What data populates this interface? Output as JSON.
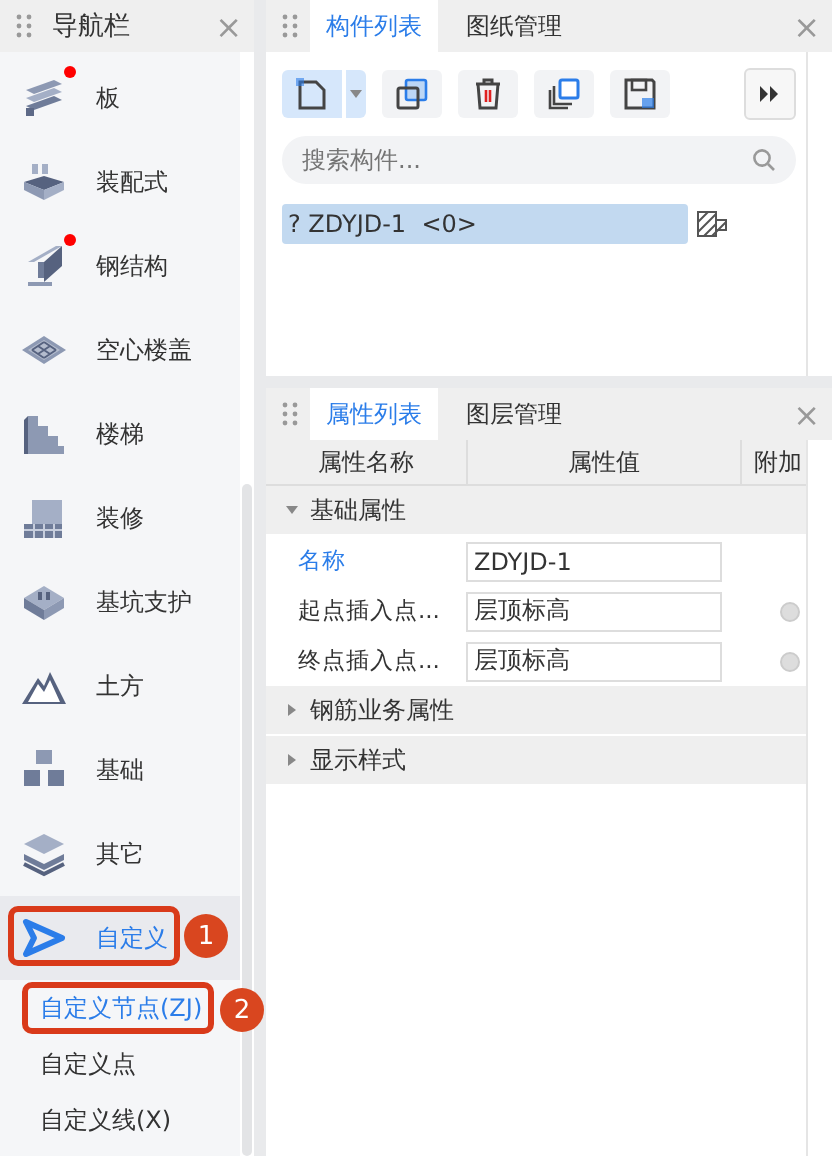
{
  "nav": {
    "title": "导航栏",
    "close": "×",
    "items": [
      {
        "label": "板",
        "badge": true,
        "selected": false
      },
      {
        "label": "装配式",
        "badge": false,
        "selected": false
      },
      {
        "label": "钢结构",
        "badge": true,
        "selected": false
      },
      {
        "label": "空心楼盖",
        "badge": false,
        "selected": false
      },
      {
        "label": "楼梯",
        "badge": false,
        "selected": false
      },
      {
        "label": "装修",
        "badge": false,
        "selected": false
      },
      {
        "label": "基坑支护",
        "badge": false,
        "selected": false
      },
      {
        "label": "土方",
        "badge": false,
        "selected": false
      },
      {
        "label": "基础",
        "badge": false,
        "selected": false
      },
      {
        "label": "其它",
        "badge": false,
        "selected": false
      },
      {
        "label": "自定义",
        "badge": false,
        "selected": true,
        "callout": "1"
      }
    ],
    "sub_items": [
      {
        "label": "自定义节点(ZJ)",
        "selected": true,
        "callout": "2"
      },
      {
        "label": "自定义点",
        "selected": false
      },
      {
        "label": "自定义线(X)",
        "selected": false
      }
    ]
  },
  "component_panel": {
    "tabs": [
      {
        "label": "构件列表",
        "selected": true
      },
      {
        "label": "图纸管理",
        "selected": false
      }
    ],
    "close": "×",
    "search": {
      "placeholder": "搜索构件..."
    },
    "items": [
      {
        "label": "? ZDYJD-1  <0>",
        "selected": true
      }
    ]
  },
  "property_panel": {
    "tabs": [
      {
        "label": "属性列表",
        "selected": true
      },
      {
        "label": "图层管理",
        "selected": false
      }
    ],
    "close": "×",
    "columns": [
      "属性名称",
      "属性值",
      "附加"
    ],
    "rows": [
      {
        "kind": "group",
        "label": "基础属性",
        "expanded": true
      },
      {
        "kind": "property",
        "name": "名称",
        "value": "ZDYJD-1",
        "highlighted": true,
        "extra": false
      },
      {
        "kind": "property",
        "name": "起点插入点...",
        "value": "层顶标高",
        "highlighted": false,
        "extra": true
      },
      {
        "kind": "property",
        "name": "终点插入点...",
        "value": "层顶标高",
        "highlighted": false,
        "extra": true
      },
      {
        "kind": "group",
        "label": "钢筋业务属性",
        "expanded": false
      },
      {
        "kind": "group",
        "label": "显示样式",
        "expanded": false
      }
    ]
  }
}
